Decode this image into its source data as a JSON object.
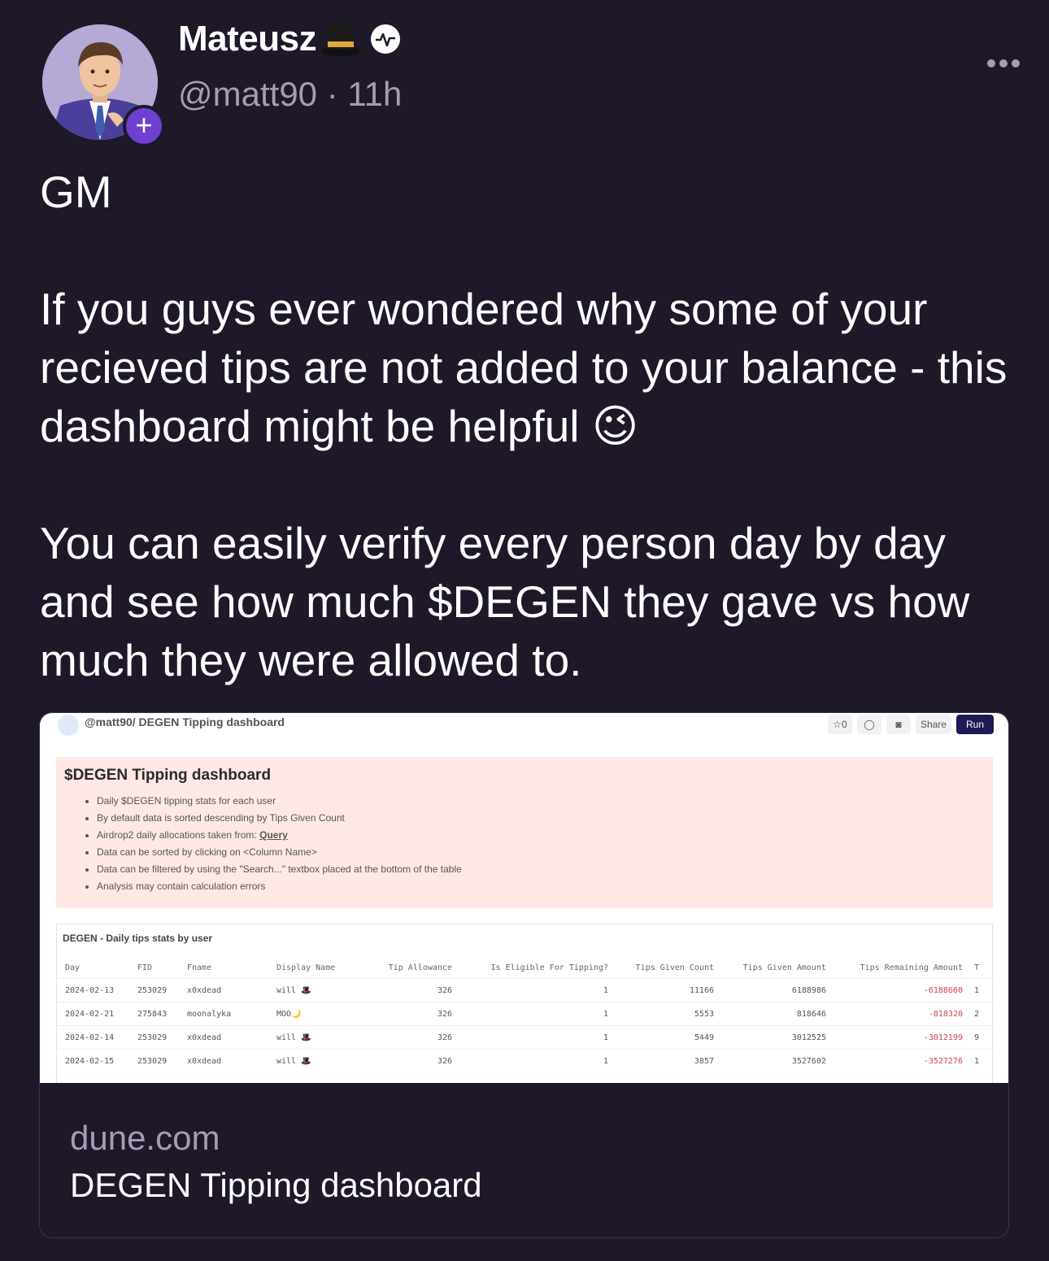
{
  "author": {
    "name": "Mateusz",
    "handle": "@matt90",
    "separator": "·",
    "time": "11h",
    "follow_label": "+"
  },
  "post": {
    "greeting": "GM",
    "para1": "If you guys ever wondered why some of your recieved tips are not added to your balance - this dashboard might be helpful",
    "para1_emoji": "😉",
    "para2": "You can easily verify every person day by day and see how much $DEGEN they gave vs how much they were allowed to."
  },
  "embed": {
    "domain": "dune.com",
    "title": "DEGEN Tipping dashboard",
    "screenshot": {
      "breadcrumb": "@matt90/ DEGEN Tipping dashboard",
      "tools": {
        "star_count": "☆0",
        "share_label": "Share",
        "run_label": "Run"
      },
      "heading": "$DEGEN Tipping dashboard",
      "bullets": [
        "Daily $DEGEN tipping stats for each user",
        "By default data is sorted descending by Tips Given Count",
        "Airdrop2 daily allocations taken from: ",
        "Data can be sorted by clicking on <Column Name>",
        "Data can be filtered by using the \"Search...\" textbox placed at the bottom of the table",
        "Analysis may contain calculation errors"
      ],
      "query_link": "Query",
      "table_title": "DEGEN - Daily tips stats by user",
      "columns": [
        "Day",
        "FID",
        "Fname",
        "Display Name",
        "Tip Allowance",
        "Is Eligible For Tipping?",
        "Tips Given Count",
        "Tips Given Amount",
        "Tips Remaining Amount",
        "T"
      ],
      "rows": [
        [
          "2024-02-13",
          "253029",
          "x0xdead",
          "will 🎩",
          "326",
          "1",
          "11166",
          "6188986",
          "-6188660",
          "1"
        ],
        [
          "2024-02-21",
          "275843",
          "moonalyka",
          "MOO🌙",
          "326",
          "1",
          "5553",
          "818646",
          "-818320",
          "2"
        ],
        [
          "2024-02-14",
          "253029",
          "x0xdead",
          "will 🎩",
          "326",
          "1",
          "5449",
          "3012525",
          "-3012199",
          "9"
        ],
        [
          "2024-02-15",
          "253029",
          "x0xdead",
          "will 🎩",
          "326",
          "1",
          "3857",
          "3527602",
          "-3527276",
          "1"
        ]
      ]
    }
  },
  "colors": {
    "background": "#1e1829",
    "accent": "#6f3fd0",
    "muted_text": "#a49db4",
    "negative": "#d0453f"
  }
}
